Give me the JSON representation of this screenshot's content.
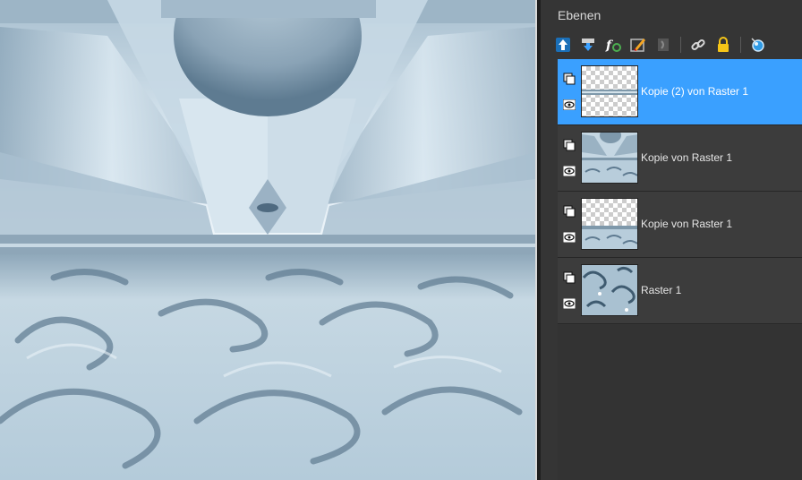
{
  "panel": {
    "title": "Ebenen",
    "toolbar": [
      {
        "icon": "new-layer-up-icon"
      },
      {
        "icon": "merge-down-icon"
      },
      {
        "icon": "effects-fx-icon"
      },
      {
        "icon": "edit-brush-icon"
      },
      {
        "icon": "mask-icon"
      },
      {
        "icon": "link-icon"
      },
      {
        "icon": "lock-icon"
      },
      {
        "icon": "layer-style-icon"
      }
    ]
  },
  "layers": [
    {
      "name": "Kopie (2) von Raster 1",
      "selected": true,
      "thumb": "strip-top"
    },
    {
      "name": "Kopie von Raster 1",
      "selected": false,
      "thumb": "full-scene"
    },
    {
      "name": "Kopie von Raster 1",
      "selected": false,
      "thumb": "strip-bottom"
    },
    {
      "name": "Raster 1",
      "selected": false,
      "thumb": "swirl-pattern"
    }
  ],
  "colors": {
    "selection": "#3aa0ff",
    "panel_bg": "#353535",
    "canvas_ice": "#c3d6e2"
  }
}
